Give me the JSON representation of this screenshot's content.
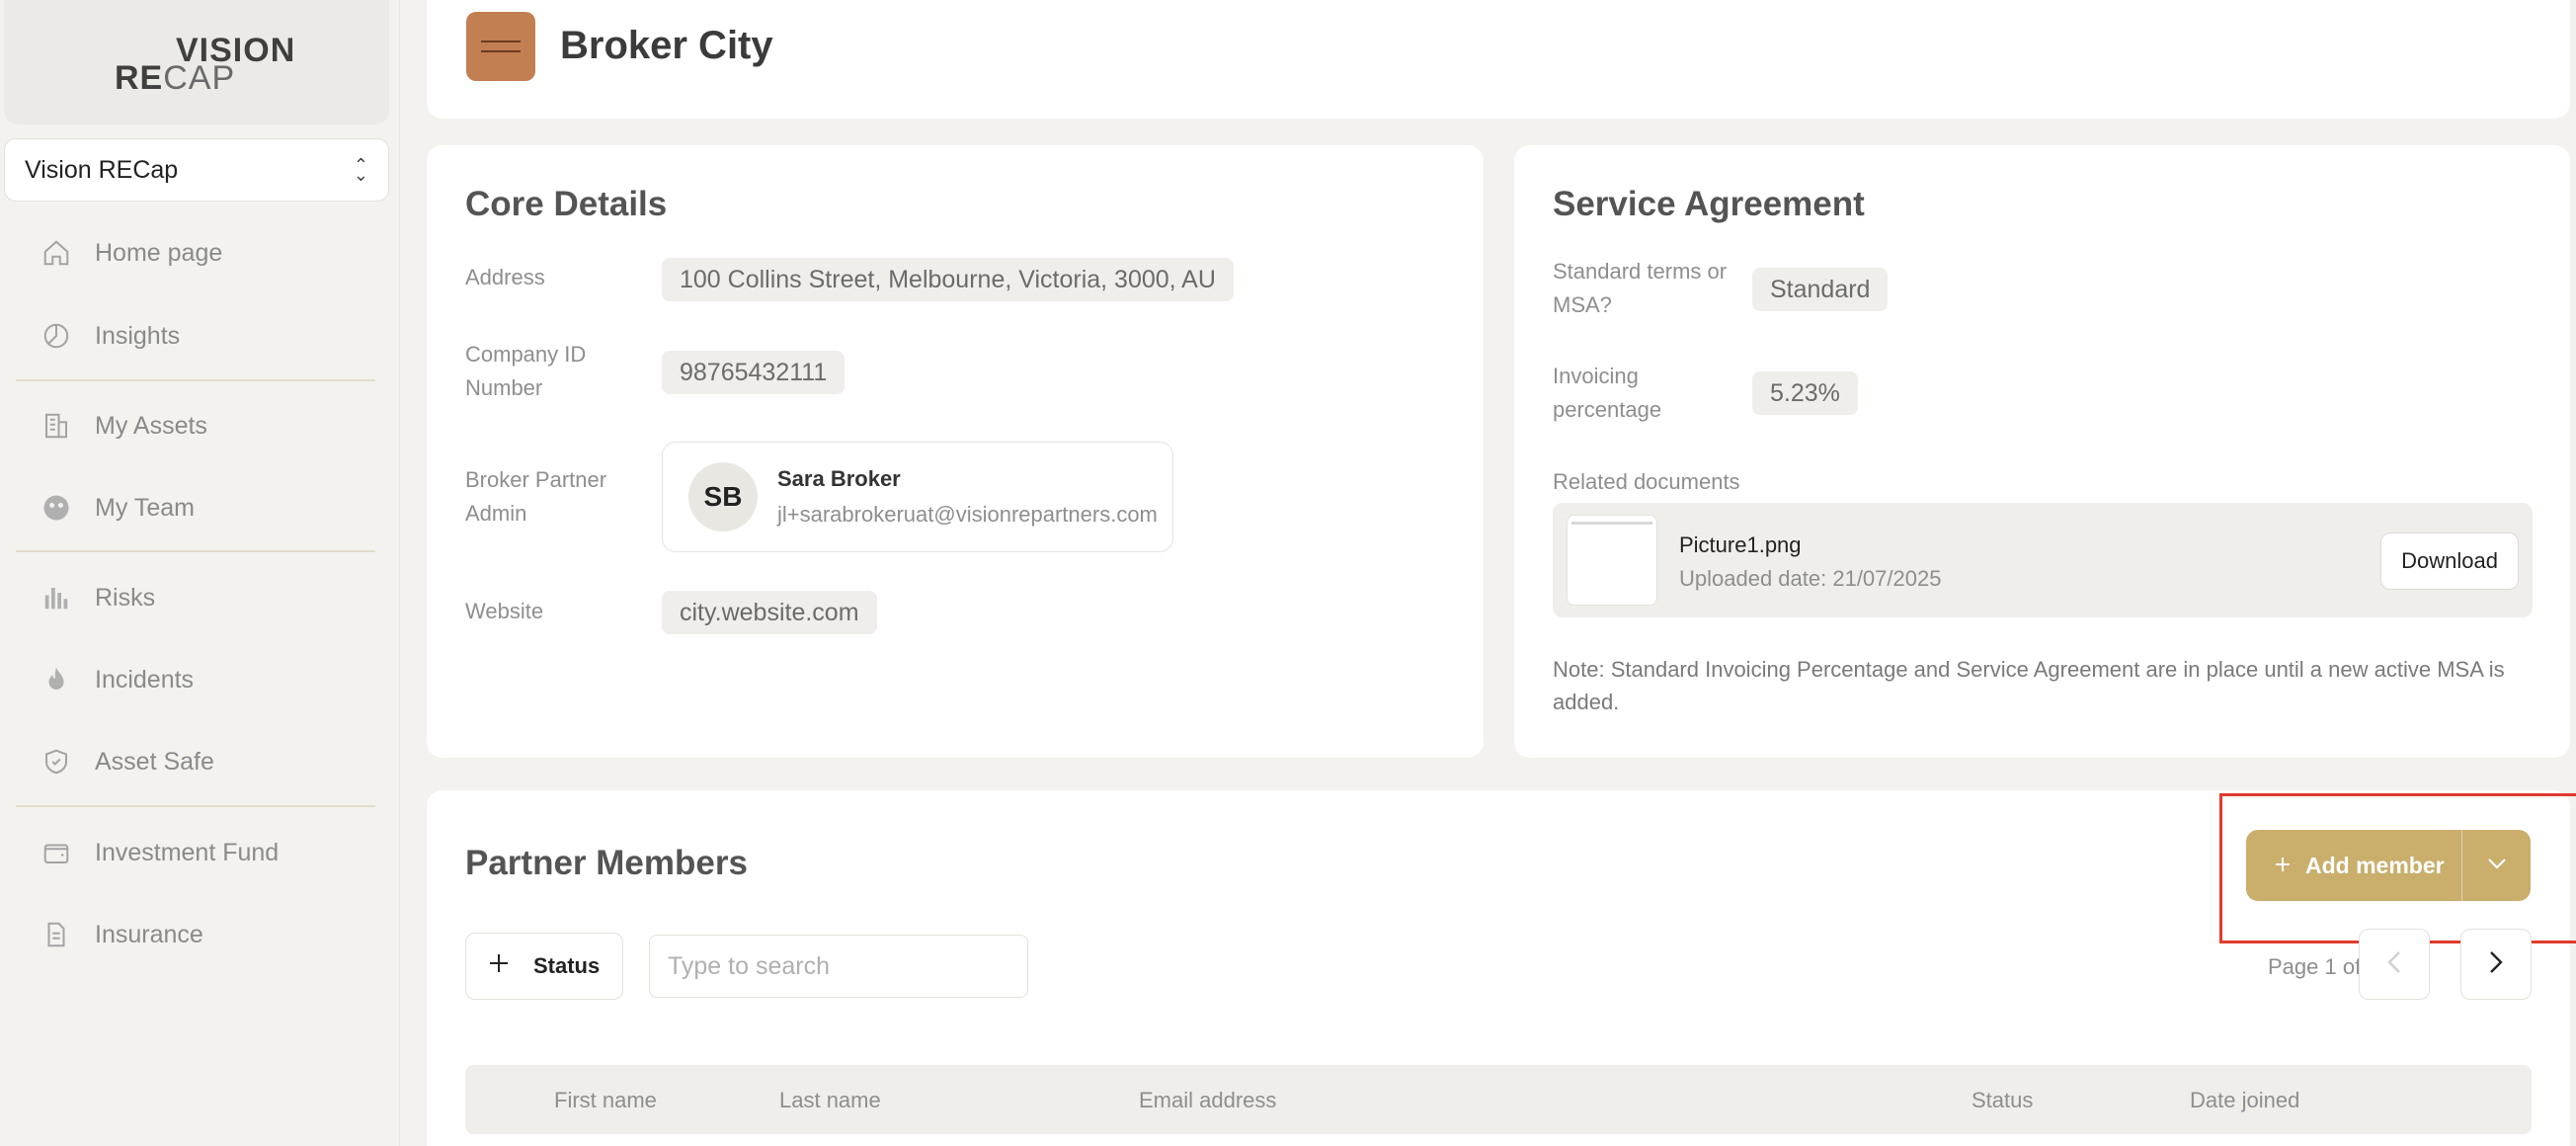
{
  "sidebar": {
    "logo": {
      "top": "VISION",
      "re": "RE",
      "cap": "CAP"
    },
    "org_select": {
      "value": "Vision RECap"
    },
    "items": [
      {
        "label": "Home page",
        "icon": "home-icon"
      },
      {
        "label": "Insights",
        "icon": "pie-chart-icon"
      },
      {
        "label": "My Assets",
        "icon": "building-icon"
      },
      {
        "label": "My Team",
        "icon": "team-icon"
      },
      {
        "label": "Risks",
        "icon": "bar-chart-icon"
      },
      {
        "label": "Incidents",
        "icon": "flame-icon"
      },
      {
        "label": "Asset Safe",
        "icon": "shield-icon"
      },
      {
        "label": "Investment Fund",
        "icon": "wallet-icon"
      },
      {
        "label": "Insurance",
        "icon": "document-icon"
      }
    ]
  },
  "header": {
    "company_name": "Broker City",
    "logo_text": "BROKER CITY"
  },
  "core": {
    "title": "Core Details",
    "address_label": "Address",
    "address": "100 Collins Street, Melbourne, Victoria, 3000, AU",
    "company_id_label": "Company ID Number",
    "company_id": "98765432111",
    "admin_label": "Broker Partner Admin",
    "admin_initials": "SB",
    "admin_name": "Sara Broker",
    "admin_email": "jl+sarabrokeruat@visionrepartners.com",
    "website_label": "Website",
    "website": "city.website.com"
  },
  "service": {
    "title": "Service Agreement",
    "terms_label": "Standard terms or MSA?",
    "terms": "Standard",
    "invoicing_label": "Invoicing percentage",
    "invoicing": "5.23%",
    "docs_label": "Related documents",
    "doc_name": "Picture1.png",
    "doc_date": "Uploaded date: 21/07/2025",
    "download_label": "Download",
    "note": "Note: Standard Invoicing Percentage and Service Agreement are in place until a new active MSA is added."
  },
  "members": {
    "title": "Partner Members",
    "add_label": "Add member",
    "status_label": "Status",
    "search_placeholder": "Type to search",
    "page_info": "Page 1 of 3",
    "columns": [
      "First name",
      "Last name",
      "Email address",
      "Status",
      "Date joined"
    ]
  },
  "colors": {
    "accent": "#c9ae6c",
    "highlight": "#e03a2b",
    "company_logo": "#c27f52"
  }
}
